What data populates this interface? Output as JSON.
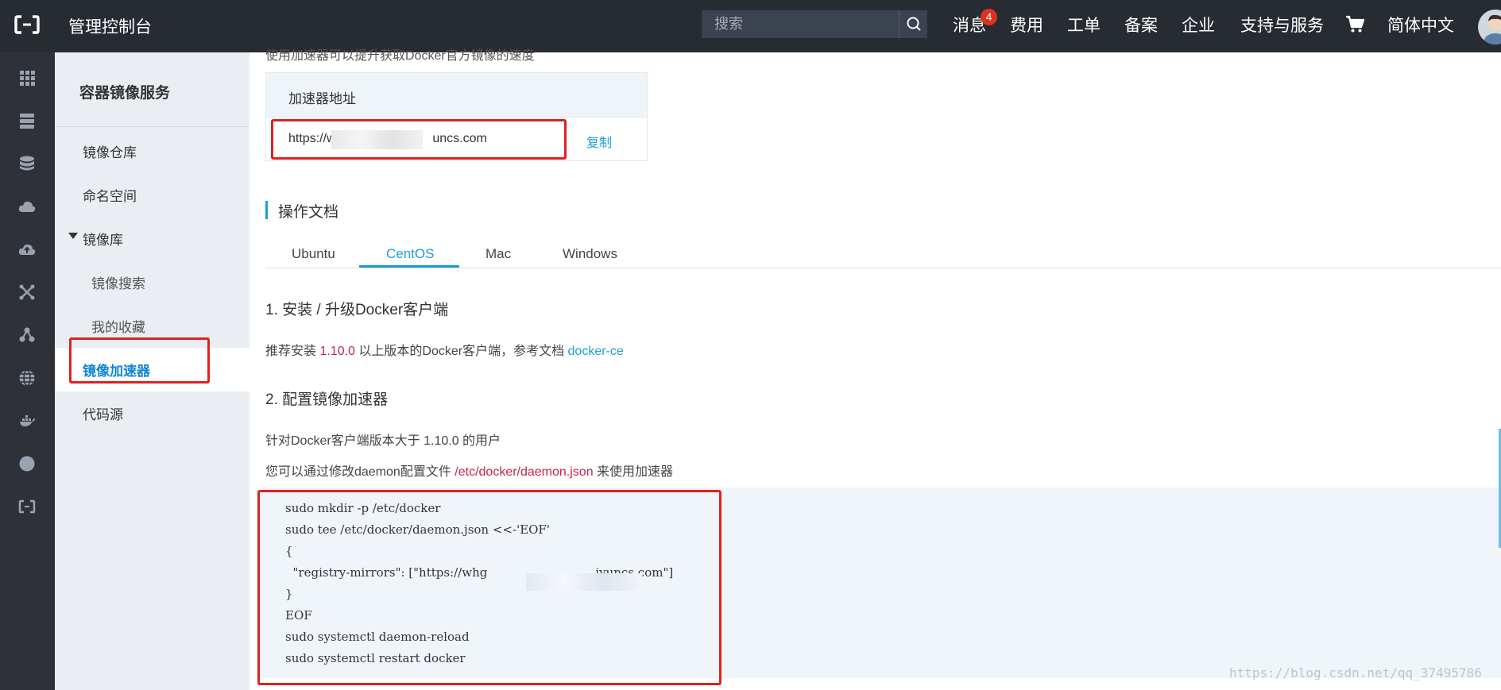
{
  "topbar": {
    "title": "管理控制台",
    "search_placeholder": "搜索",
    "nav": {
      "messages": "消息",
      "messages_badge": "4",
      "billing": "费用",
      "tickets": "工单",
      "filing": "备案",
      "enterprise": "企业",
      "support": "支持与服务",
      "language": "简体中文"
    }
  },
  "sidebar": {
    "title": "容器镜像服务",
    "items": {
      "repo": "镜像仓库",
      "namespace": "命名空间",
      "library": "镜像库",
      "search": "镜像搜索",
      "favorites": "我的收藏",
      "accelerator": "镜像加速器",
      "code_source": "代码源"
    }
  },
  "main": {
    "intro_text": "使用加速器可以提升获取Docker官方镜像的速度",
    "accelerator": {
      "header": "加速器地址",
      "url_prefix": "https://whg",
      "url_suffix": "uncs.com",
      "copy": "复制"
    },
    "docs_title": "操作文档",
    "tabs": [
      "Ubuntu",
      "CentOS",
      "Mac",
      "Windows"
    ],
    "active_tab": "CentOS",
    "step1": {
      "title": "1. 安装 / 升级Docker客户端",
      "text_before": "推荐安装 ",
      "version": "1.10.0",
      "text_middle": " 以上版本的Docker客户端，参考文档 ",
      "link": "docker-ce"
    },
    "step2": {
      "title": "2. 配置镜像加速器",
      "line1": "针对Docker客户端版本大于 1.10.0 的用户",
      "line2_before": "您可以通过修改daemon配置文件 ",
      "line2_path": "/etc/docker/daemon.json",
      "line2_after": " 来使用加速器"
    },
    "code": [
      "sudo mkdir -p /etc/docker",
      "sudo tee /etc/docker/daemon.json <<-'EOF'",
      "{",
      "  \"registry-mirrors\": [\"https://whg",
      "}",
      "EOF",
      "sudo systemctl daemon-reload",
      "sudo systemctl restart docker"
    ],
    "code_mirror_suffix": "iyuncs.com\"]"
  },
  "watermark": "https://blog.csdn.net/qq_37495786",
  "colors": {
    "topbar_bg": "#272c33",
    "accent_blue": "#1a9fd6",
    "highlight_red": "#e02020",
    "badge_red": "#e0301e"
  }
}
